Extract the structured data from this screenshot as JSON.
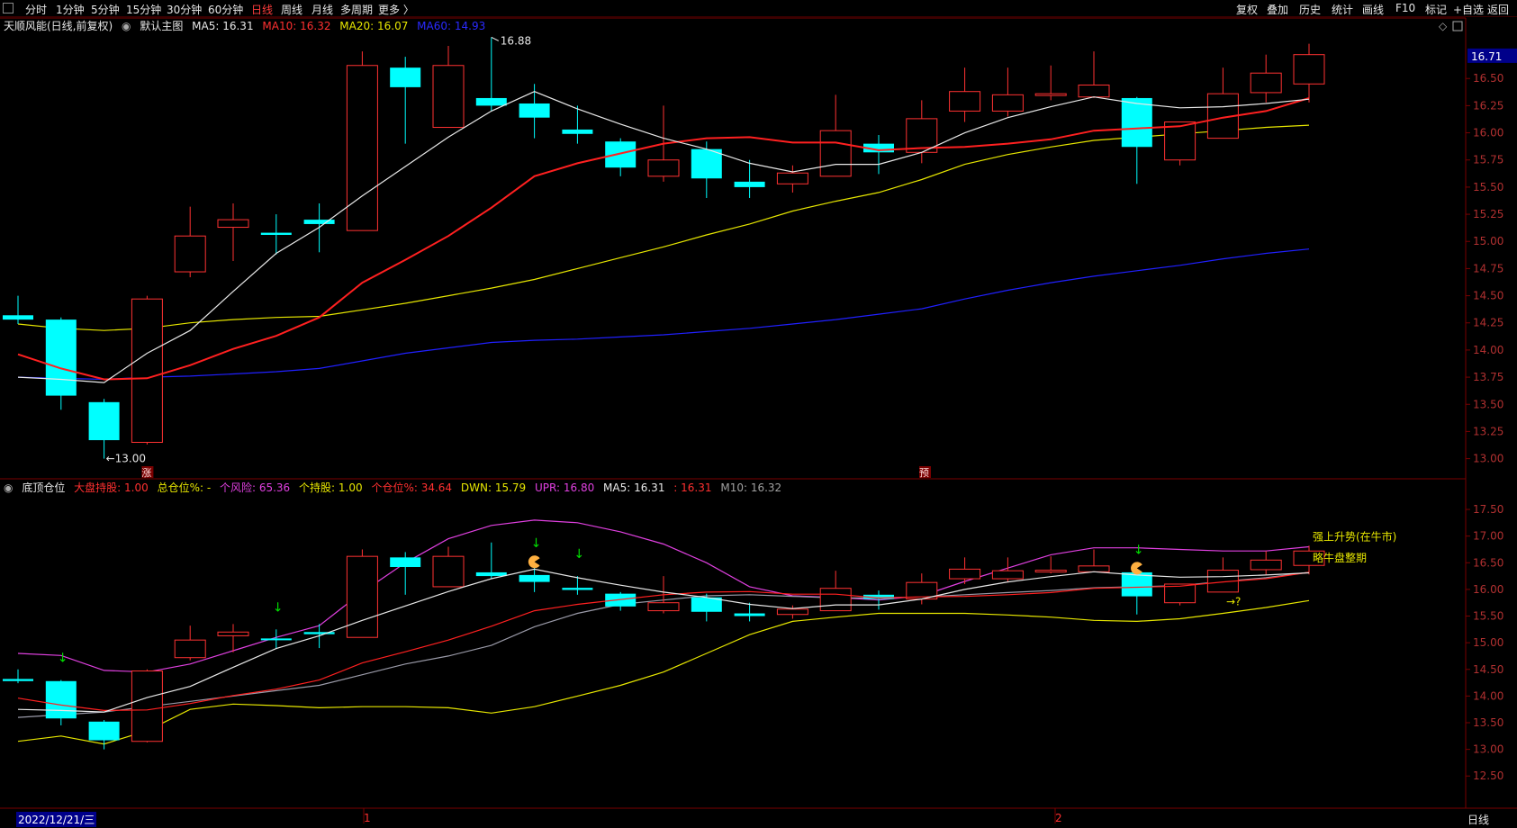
{
  "toolbar": {
    "left": [
      "分时",
      "1分钟",
      "5分钟",
      "15分钟",
      "30分钟",
      "60分钟",
      "日线",
      "周线",
      "月线",
      "多周期",
      "更多 〉"
    ],
    "active": "日线",
    "right": [
      "复权",
      "叠加",
      "历史",
      "统计",
      "画线",
      "F10",
      "标记",
      "+自选",
      "返回"
    ]
  },
  "main": {
    "stock_title": "天顺风能(日线,前复权)",
    "panel_name": "默认主图",
    "ma5": "MA5: 16.31",
    "ma10": "MA10: 16.32",
    "ma20": "MA20: 16.07",
    "ma60": "MA60: 14.93",
    "high_label": "16.88",
    "low_label": "13.00",
    "price_tag": "16.71",
    "marker_zhang": "涨",
    "marker_yu": "预"
  },
  "indicator": {
    "name": "底顶仓位",
    "dapan": "大盘持股: 1.00",
    "zong": "总仓位%: -",
    "gefengxian": "个风险: 65.36",
    "gechigu": "个持股: 1.00",
    "gecangwei": "个仓位%: 34.64",
    "dwn": "DWN: 15.79",
    "upr": "UPR: 16.80",
    "ma5": "MA5: 16.31",
    "blank": ": 16.31",
    "m10": "M10: 16.32",
    "label1": "强上升势(在牛市)",
    "label2": "略牛盘整期",
    "qmark": "→?"
  },
  "footer": {
    "date": "2022/12/21/三",
    "month1": "1",
    "month2": "2",
    "period": "日线"
  },
  "colors": {
    "up": "#ff3232",
    "down": "#00ffff",
    "ma5": "#e8e8e8",
    "ma10": "#ff2020",
    "ma20": "#e6e600",
    "ma60": "#2020ff",
    "upr": "#e040e0",
    "grid": "#7a0000"
  },
  "chart_data": {
    "type": "candlestick",
    "dates_first": "2022/12/21",
    "candles": [
      [
        14.32,
        14.28,
        14.5,
        14.24
      ],
      [
        14.28,
        13.58,
        14.3,
        13.45
      ],
      [
        13.52,
        13.17,
        13.55,
        13.0
      ],
      [
        13.15,
        14.47,
        14.5,
        13.13
      ],
      [
        14.72,
        15.05,
        15.32,
        14.67
      ],
      [
        15.13,
        15.2,
        15.35,
        14.82
      ],
      [
        15.08,
        15.06,
        15.25,
        14.88
      ],
      [
        15.2,
        15.16,
        15.35,
        14.9
      ],
      [
        15.1,
        16.62,
        16.75,
        15.1
      ],
      [
        16.6,
        16.42,
        16.7,
        15.9
      ],
      [
        16.05,
        16.62,
        16.8,
        16.05
      ],
      [
        16.32,
        16.25,
        16.88,
        16.2
      ],
      [
        16.27,
        16.14,
        16.45,
        15.95
      ],
      [
        16.03,
        15.99,
        16.25,
        15.9
      ],
      [
        15.92,
        15.68,
        15.95,
        15.6
      ],
      [
        15.6,
        15.75,
        16.25,
        15.55
      ],
      [
        15.85,
        15.58,
        15.92,
        15.4
      ],
      [
        15.55,
        15.5,
        15.75,
        15.4
      ],
      [
        15.53,
        15.63,
        15.7,
        15.45
      ],
      [
        15.6,
        16.02,
        16.35,
        15.6
      ],
      [
        15.9,
        15.82,
        15.98,
        15.62
      ],
      [
        15.82,
        16.13,
        16.3,
        15.72
      ],
      [
        16.2,
        16.38,
        16.6,
        16.1
      ],
      [
        16.2,
        16.35,
        16.6,
        16.15
      ],
      [
        16.35,
        16.36,
        16.62,
        16.3
      ],
      [
        16.33,
        16.44,
        16.75,
        16.32
      ],
      [
        16.32,
        15.87,
        16.33,
        15.53
      ],
      [
        15.75,
        16.1,
        16.1,
        15.7
      ],
      [
        15.95,
        16.36,
        16.6,
        15.95
      ],
      [
        16.37,
        16.55,
        16.72,
        16.28
      ],
      [
        16.45,
        16.72,
        16.82,
        16.28
      ]
    ],
    "ma5": [
      13.75,
      13.73,
      13.7,
      13.97,
      14.18,
      14.54,
      14.89,
      15.13,
      15.42,
      15.69,
      15.96,
      16.2,
      16.38,
      16.22,
      16.08,
      15.95,
      15.85,
      15.72,
      15.64,
      15.71,
      15.71,
      15.82,
      16.0,
      16.14,
      16.24,
      16.33,
      16.27,
      16.23,
      16.24,
      16.27,
      16.31
    ],
    "ma10": [
      13.96,
      13.83,
      13.73,
      13.74,
      13.86,
      14.01,
      14.13,
      14.3,
      14.62,
      14.83,
      15.05,
      15.31,
      15.6,
      15.72,
      15.81,
      15.9,
      15.95,
      15.96,
      15.91,
      15.91,
      15.84,
      15.86,
      15.87,
      15.9,
      15.94,
      16.02,
      16.04,
      16.06,
      16.14,
      16.2,
      16.32
    ],
    "ma20": [
      14.24,
      14.2,
      14.18,
      14.2,
      14.25,
      14.28,
      14.3,
      14.31,
      14.37,
      14.43,
      14.5,
      14.57,
      14.65,
      14.75,
      14.85,
      14.95,
      15.06,
      15.16,
      15.28,
      15.37,
      15.45,
      15.57,
      15.71,
      15.8,
      15.87,
      15.93,
      15.96,
      15.99,
      16.02,
      16.05,
      16.07
    ],
    "ma60": [
      13.75,
      13.74,
      13.73,
      13.75,
      13.76,
      13.78,
      13.8,
      13.83,
      13.9,
      13.97,
      14.02,
      14.07,
      14.09,
      14.1,
      14.12,
      14.14,
      14.17,
      14.2,
      14.24,
      14.28,
      14.33,
      14.38,
      14.47,
      14.55,
      14.62,
      14.68,
      14.73,
      14.78,
      14.84,
      14.89,
      14.93
    ],
    "upr": [
      14.8,
      14.76,
      14.48,
      14.45,
      14.6,
      14.85,
      15.1,
      15.32,
      15.95,
      16.5,
      16.95,
      17.2,
      17.3,
      17.25,
      17.08,
      16.85,
      16.5,
      16.05,
      15.88,
      15.85,
      15.8,
      15.88,
      16.15,
      16.4,
      16.65,
      16.78,
      16.78,
      16.75,
      16.72,
      16.72,
      16.8
    ],
    "dwn": [
      13.15,
      13.25,
      13.1,
      13.35,
      13.75,
      13.85,
      13.82,
      13.78,
      13.8,
      13.8,
      13.78,
      13.68,
      13.8,
      14.0,
      14.2,
      14.45,
      14.8,
      15.15,
      15.4,
      15.48,
      15.55,
      15.55,
      15.55,
      15.52,
      15.48,
      15.42,
      15.4,
      15.45,
      15.55,
      15.66,
      15.79
    ],
    "ind_ma10_grey": [
      13.6,
      13.65,
      13.7,
      13.8,
      13.9,
      14.0,
      14.1,
      14.2,
      14.4,
      14.6,
      14.75,
      14.95,
      15.3,
      15.55,
      15.72,
      15.8,
      15.88,
      15.9,
      15.87,
      15.84,
      15.84,
      15.86,
      15.9,
      15.94,
      15.98,
      16.03,
      16.05,
      16.07,
      16.15,
      16.22,
      16.32
    ],
    "main_ylim": [
      12.98,
      16.85
    ],
    "main_ticks": [
      "16.50",
      "16.25",
      "16.00",
      "15.75",
      "15.50",
      "15.25",
      "15.00",
      "14.75",
      "14.50",
      "14.25",
      "14.00",
      "13.75",
      "13.50",
      "13.25",
      "13.00"
    ],
    "ind_ylim": [
      12.2,
      17.72
    ],
    "ind_ticks": [
      "17.50",
      "17.00",
      "16.50",
      "16.00",
      "15.50",
      "15.00",
      "14.50",
      "14.00",
      "13.50",
      "13.00",
      "12.50"
    ],
    "green_arrow_idx": [
      1,
      6,
      12,
      13,
      26
    ],
    "pacman_idx": [
      12,
      26
    ]
  }
}
